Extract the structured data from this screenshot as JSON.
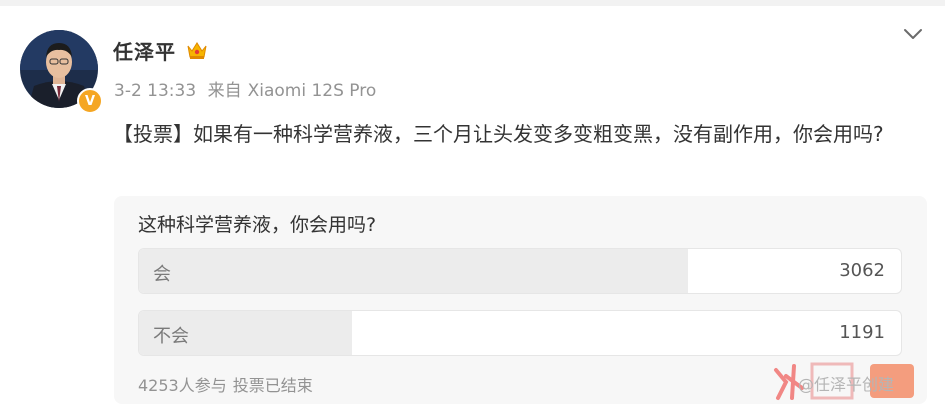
{
  "post": {
    "author": "任泽平",
    "timestamp": "3-2 13:33",
    "source_prefix": "来自",
    "source_device": "Xiaomi 12S Pro",
    "body_text": "【投票】如果有一种科学营养液，三个月让头发变多变粗变黑，没有副作用，你会用吗?"
  },
  "poll": {
    "question": "这种科学营养液，你会用吗?",
    "options": [
      {
        "label": "会",
        "count": "3062",
        "share": 0.72
      },
      {
        "label": "不会",
        "count": "1191",
        "share": 0.28
      }
    ],
    "participants": "4253人参与",
    "status": "投票已结束"
  },
  "watermark": {
    "text": "@任泽平创建"
  },
  "icons": {
    "crown": "crown-badge-icon",
    "verified": "verified-v-icon",
    "menu": "chevron-down-icon"
  },
  "colors": {
    "verified": "#f5a623",
    "vote_fill": "#ececec",
    "meta_text": "#939393"
  }
}
